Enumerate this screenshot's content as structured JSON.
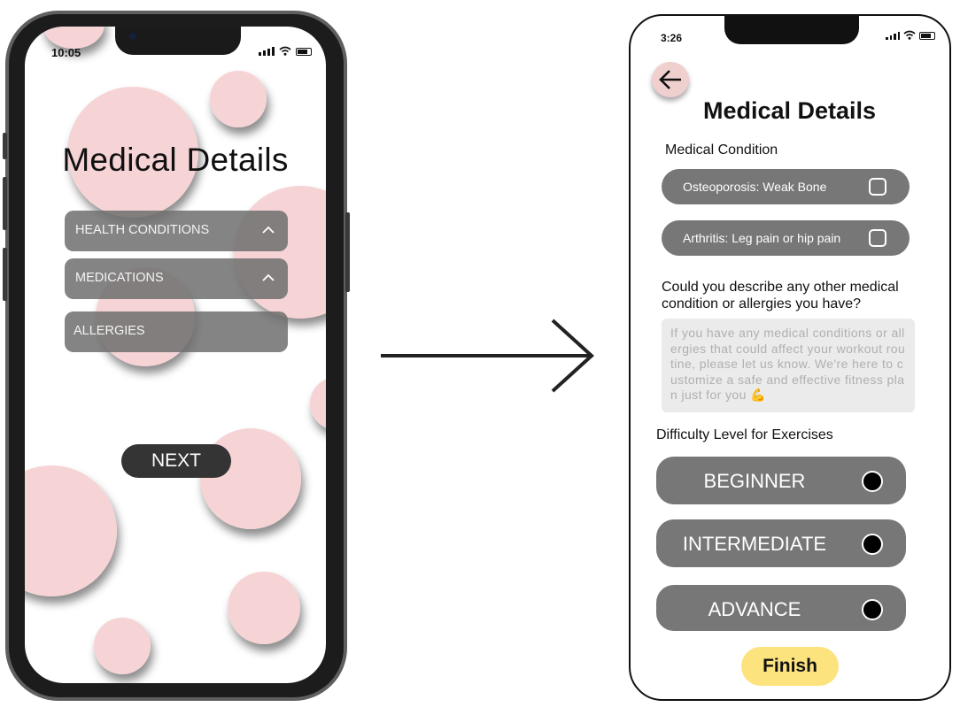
{
  "left_phone": {
    "time": "10:05",
    "title": "Medical Details",
    "sections": [
      {
        "label": "HEALTH CONDITIONS",
        "icon": "chevron-up-icon"
      },
      {
        "label": "MEDICATIONS",
        "icon": "chevron-up-icon"
      },
      {
        "label": "ALLERGIES"
      }
    ],
    "next_label": "NEXT",
    "bubble_color": "#f4c8ca"
  },
  "right_phone": {
    "time": "3:26",
    "back_icon": "arrow-left-icon",
    "title": "Medical Details",
    "medical_condition_label": "Medical Condition",
    "conditions": [
      {
        "label": "Osteoporosis: Weak Bone",
        "checked": false
      },
      {
        "label": "Arthritis: Leg pain or hip pain",
        "checked": false
      }
    ],
    "describe_question": "Could you describe any other medical condition or allergies you have?",
    "describe_placeholder": "If you have any medical conditions or allergies that could affect your workout routine, please let us know. We're here to customize a safe and effective fitness plan just for you 💪",
    "difficulty_label": "Difficulty Level for Exercises",
    "levels": [
      {
        "label": "BEGINNER"
      },
      {
        "label": "INTERMEDIATE"
      },
      {
        "label": "ADVANCE"
      }
    ],
    "finish_label": "Finish",
    "accent_color": "#fce37e",
    "pill_color": "#777777"
  },
  "transition_icon": "arrow-right-icon"
}
